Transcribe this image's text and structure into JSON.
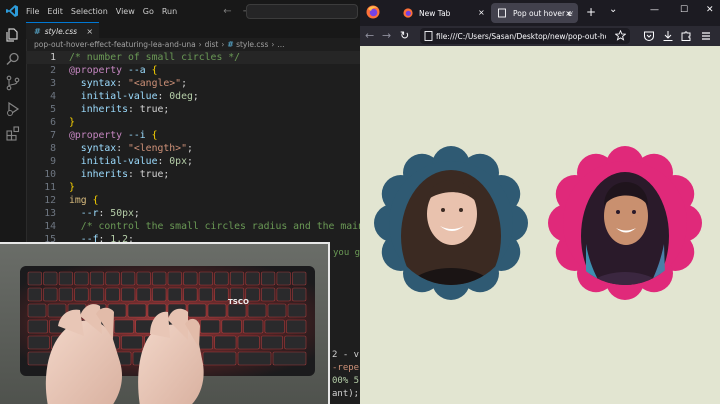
{
  "vscode": {
    "menu": [
      "File",
      "Edit",
      "Selection",
      "View",
      "Go",
      "Run"
    ],
    "nav_arrows": "← →",
    "tab": {
      "icon": "#",
      "name": "style.css"
    },
    "breadcrumb": {
      "folder1": "pop-out-hover-effect-featuring-lea-and-una",
      "folder2": "dist",
      "file_icon": "#",
      "file": "style.css",
      "more": "..."
    },
    "lines": [
      {
        "n": "1"
      },
      {
        "n": "2"
      },
      {
        "n": "3"
      },
      {
        "n": "4"
      },
      {
        "n": "5"
      },
      {
        "n": "6"
      },
      {
        "n": "7"
      },
      {
        "n": "8"
      },
      {
        "n": "9"
      },
      {
        "n": "10"
      },
      {
        "n": "11"
      },
      {
        "n": "12"
      },
      {
        "n": "13"
      },
      {
        "n": "14"
      },
      {
        "n": "15"
      }
    ],
    "code": {
      "l1": "/* number of small circles */",
      "l2_at": "@property",
      "l2_var": " --a",
      "l2_br": " {",
      "l3_prop": "  syntax",
      "l3_p": ": ",
      "l3_str": "\"<angle>\"",
      "l3_end": ";",
      "l4_prop": "  initial-value",
      "l4_p": ": ",
      "l4_num": "0deg",
      "l4_end": ";",
      "l5_prop": "  inherits",
      "l5_p": ": ",
      "l5_val": "true",
      "l5_end": ";",
      "l6": "}",
      "l7_at": "@property",
      "l7_var": " --i",
      "l7_br": " {",
      "l8_prop": "  syntax",
      "l8_p": ": ",
      "l8_str": "\"<length>\"",
      "l8_end": ";",
      "l9_prop": "  initial-value",
      "l9_p": ": ",
      "l9_num": "0px",
      "l9_end": ";",
      "l10_prop": "  inherits",
      "l10_p": ": ",
      "l10_val": "true",
      "l10_end": ";",
      "l11": "}",
      "l12_sel": "img",
      "l12_br": " {",
      "l13_var": "  --r",
      "l13_p": ": ",
      "l13_num": "50px",
      "l13_end": ";",
      "l14": "  /* control the small circles radius and the main siz",
      "l15_pre": "  ",
      "l15_var": "--f",
      "l15_p": ": ",
      "l15_num": "1.2",
      "l15_end": ";"
    },
    "tail": {
      "t1": "you g",
      "t2": "2 - v",
      "t3": "-repe",
      "t4": "00% 5",
      "t5": "ant);"
    }
  },
  "firefox": {
    "tab1_title": "New Tab",
    "tab2_title": "Pop out hover effect featuring",
    "tab_close": "×",
    "new_tab": "+",
    "tab_list": "⌄",
    "win_min": "—",
    "win_max": "☐",
    "win_close": "✕",
    "back": "←",
    "forward": "→",
    "reload": "↻",
    "url": "file:///C:/Users/Sasan/Desktop/new/pop-out-hover-effect-featuring-lea-and-una/dist/index.html"
  },
  "colors": {
    "page_bg": "#e2e5d1",
    "flower1": "#2f5a73",
    "flower2": "#e0297a"
  }
}
